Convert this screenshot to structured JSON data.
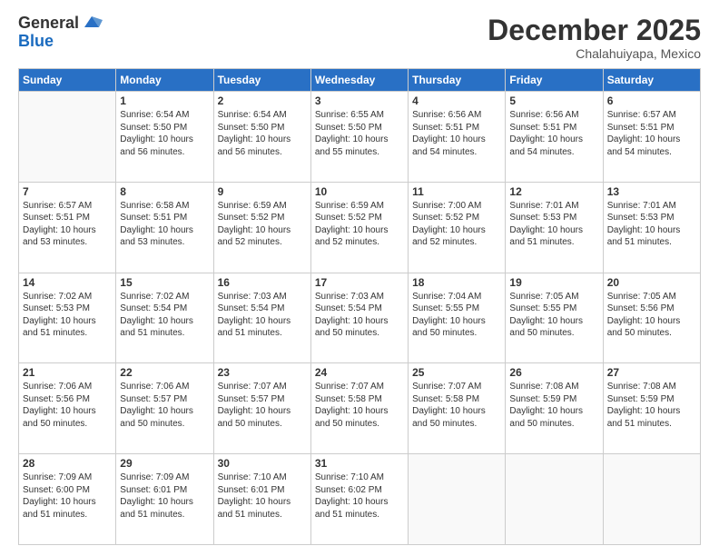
{
  "header": {
    "logo_general": "General",
    "logo_blue": "Blue",
    "month_title": "December 2025",
    "location": "Chalahuiyapa, Mexico"
  },
  "days_of_week": [
    "Sunday",
    "Monday",
    "Tuesday",
    "Wednesday",
    "Thursday",
    "Friday",
    "Saturday"
  ],
  "weeks": [
    [
      {
        "day": "",
        "empty": true
      },
      {
        "day": "1",
        "sunrise": "6:54 AM",
        "sunset": "5:50 PM",
        "daylight": "10 hours and 56 minutes."
      },
      {
        "day": "2",
        "sunrise": "6:54 AM",
        "sunset": "5:50 PM",
        "daylight": "10 hours and 56 minutes."
      },
      {
        "day": "3",
        "sunrise": "6:55 AM",
        "sunset": "5:50 PM",
        "daylight": "10 hours and 55 minutes."
      },
      {
        "day": "4",
        "sunrise": "6:56 AM",
        "sunset": "5:51 PM",
        "daylight": "10 hours and 54 minutes."
      },
      {
        "day": "5",
        "sunrise": "6:56 AM",
        "sunset": "5:51 PM",
        "daylight": "10 hours and 54 minutes."
      },
      {
        "day": "6",
        "sunrise": "6:57 AM",
        "sunset": "5:51 PM",
        "daylight": "10 hours and 54 minutes."
      }
    ],
    [
      {
        "day": "7",
        "sunrise": "6:57 AM",
        "sunset": "5:51 PM",
        "daylight": "10 hours and 53 minutes."
      },
      {
        "day": "8",
        "sunrise": "6:58 AM",
        "sunset": "5:51 PM",
        "daylight": "10 hours and 53 minutes."
      },
      {
        "day": "9",
        "sunrise": "6:59 AM",
        "sunset": "5:52 PM",
        "daylight": "10 hours and 52 minutes."
      },
      {
        "day": "10",
        "sunrise": "6:59 AM",
        "sunset": "5:52 PM",
        "daylight": "10 hours and 52 minutes."
      },
      {
        "day": "11",
        "sunrise": "7:00 AM",
        "sunset": "5:52 PM",
        "daylight": "10 hours and 52 minutes."
      },
      {
        "day": "12",
        "sunrise": "7:01 AM",
        "sunset": "5:53 PM",
        "daylight": "10 hours and 51 minutes."
      },
      {
        "day": "13",
        "sunrise": "7:01 AM",
        "sunset": "5:53 PM",
        "daylight": "10 hours and 51 minutes."
      }
    ],
    [
      {
        "day": "14",
        "sunrise": "7:02 AM",
        "sunset": "5:53 PM",
        "daylight": "10 hours and 51 minutes."
      },
      {
        "day": "15",
        "sunrise": "7:02 AM",
        "sunset": "5:54 PM",
        "daylight": "10 hours and 51 minutes."
      },
      {
        "day": "16",
        "sunrise": "7:03 AM",
        "sunset": "5:54 PM",
        "daylight": "10 hours and 51 minutes."
      },
      {
        "day": "17",
        "sunrise": "7:03 AM",
        "sunset": "5:54 PM",
        "daylight": "10 hours and 50 minutes."
      },
      {
        "day": "18",
        "sunrise": "7:04 AM",
        "sunset": "5:55 PM",
        "daylight": "10 hours and 50 minutes."
      },
      {
        "day": "19",
        "sunrise": "7:05 AM",
        "sunset": "5:55 PM",
        "daylight": "10 hours and 50 minutes."
      },
      {
        "day": "20",
        "sunrise": "7:05 AM",
        "sunset": "5:56 PM",
        "daylight": "10 hours and 50 minutes."
      }
    ],
    [
      {
        "day": "21",
        "sunrise": "7:06 AM",
        "sunset": "5:56 PM",
        "daylight": "10 hours and 50 minutes."
      },
      {
        "day": "22",
        "sunrise": "7:06 AM",
        "sunset": "5:57 PM",
        "daylight": "10 hours and 50 minutes."
      },
      {
        "day": "23",
        "sunrise": "7:07 AM",
        "sunset": "5:57 PM",
        "daylight": "10 hours and 50 minutes."
      },
      {
        "day": "24",
        "sunrise": "7:07 AM",
        "sunset": "5:58 PM",
        "daylight": "10 hours and 50 minutes."
      },
      {
        "day": "25",
        "sunrise": "7:07 AM",
        "sunset": "5:58 PM",
        "daylight": "10 hours and 50 minutes."
      },
      {
        "day": "26",
        "sunrise": "7:08 AM",
        "sunset": "5:59 PM",
        "daylight": "10 hours and 50 minutes."
      },
      {
        "day": "27",
        "sunrise": "7:08 AM",
        "sunset": "5:59 PM",
        "daylight": "10 hours and 51 minutes."
      }
    ],
    [
      {
        "day": "28",
        "sunrise": "7:09 AM",
        "sunset": "6:00 PM",
        "daylight": "10 hours and 51 minutes."
      },
      {
        "day": "29",
        "sunrise": "7:09 AM",
        "sunset": "6:01 PM",
        "daylight": "10 hours and 51 minutes."
      },
      {
        "day": "30",
        "sunrise": "7:10 AM",
        "sunset": "6:01 PM",
        "daylight": "10 hours and 51 minutes."
      },
      {
        "day": "31",
        "sunrise": "7:10 AM",
        "sunset": "6:02 PM",
        "daylight": "10 hours and 51 minutes."
      },
      {
        "day": "",
        "empty": true
      },
      {
        "day": "",
        "empty": true
      },
      {
        "day": "",
        "empty": true
      }
    ]
  ]
}
